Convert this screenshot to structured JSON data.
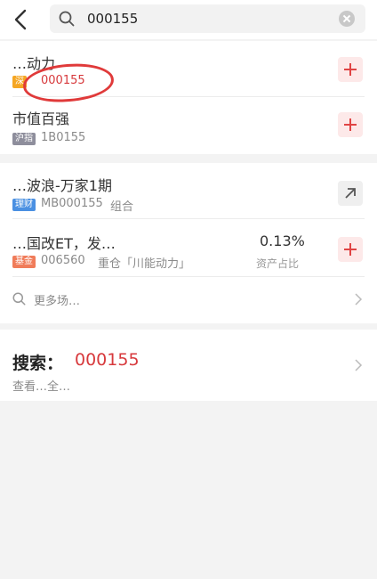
{
  "search": {
    "query": "000155"
  },
  "results": [
    {
      "title": "…动力",
      "tag": "深",
      "code": "000155"
    },
    {
      "title": "市值百强",
      "tag": "沪指",
      "code": "1B0155"
    }
  ],
  "portfolio": [
    {
      "title": "…波浪-万家1期",
      "tag": "理财",
      "code": "MB000155",
      "extra": "组合"
    },
    {
      "title": "…国改ET，发…",
      "tag": "基金",
      "code": "006560",
      "extra": "重仓「川能动力」",
      "percent": "0.13%",
      "percent_label": "资产占比"
    }
  ],
  "more_link": "更多场…",
  "search_all": {
    "label": "搜索：",
    "keyword": "000155",
    "sub": "查看…全…"
  },
  "colors": {
    "accent_red": "#d7393c",
    "add_bg": "#fde9e9",
    "circle": "#e03a3a"
  }
}
